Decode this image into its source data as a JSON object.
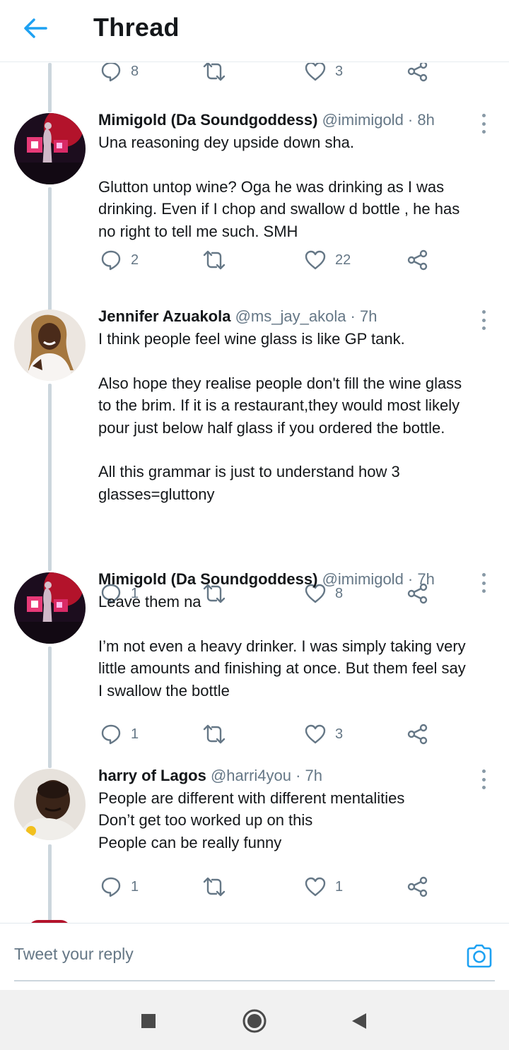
{
  "header": {
    "title": "Thread"
  },
  "top_actions": {
    "replies": "8",
    "likes": "3"
  },
  "tweets": [
    {
      "name": "Mimigold (Da Soundgoddess)",
      "handle": "@imimigold · 8h",
      "paragraphs": [
        [
          "Una reasoning dey upside down sha."
        ],
        [
          "Glutton untop wine? Oga he was drinking as I was",
          "drinking. Even if I chop and swallow d bottle , he has",
          "no right to tell me such. SMH"
        ]
      ],
      "replies": "2",
      "likes": "22"
    },
    {
      "name": "Jennifer Azuakola",
      "handle": "@ms_jay_akola · 7h",
      "paragraphs": [
        [
          "I think people feel wine glass is like GP tank."
        ],
        [
          "Also hope they realise people don't fill the wine glass",
          "to the brim. If it is a restaurant,they would most likely",
          "pour just below half glass if you ordered the bottle."
        ],
        [
          "All this grammar is just to understand how 3",
          "glasses=gluttony"
        ]
      ],
      "replies": "1",
      "likes": "8"
    },
    {
      "name": "Mimigold (Da Soundgoddess)",
      "handle": "@imimigold · 7h",
      "paragraphs": [
        [
          "Leave them na"
        ],
        [
          "I’m not even a heavy drinker. I was simply taking very",
          "little amounts and finishing at once. But them feel say",
          "I swallow the bottle"
        ]
      ],
      "replies": "1",
      "likes": "3"
    },
    {
      "name": "harry of Lagos",
      "handle": "@harri4you · 7h",
      "paragraphs": [
        [
          "People are different with different mentalities",
          "Don’t get too worked up on this",
          "People can be really funny"
        ]
      ],
      "replies": "1",
      "likes": "1"
    }
  ],
  "reply_box": {
    "placeholder": "Tweet your reply"
  },
  "icons": {
    "back": "arrow-left-icon",
    "reply": "speech-bubble-icon",
    "retweet": "retweet-icon",
    "like": "heart-icon",
    "share": "share-icon",
    "more": "vertical-dots-icon",
    "camera": "camera-icon"
  },
  "colors": {
    "accent": "#1da1f2",
    "muted": "#657786",
    "line": "#ccd6dd"
  }
}
